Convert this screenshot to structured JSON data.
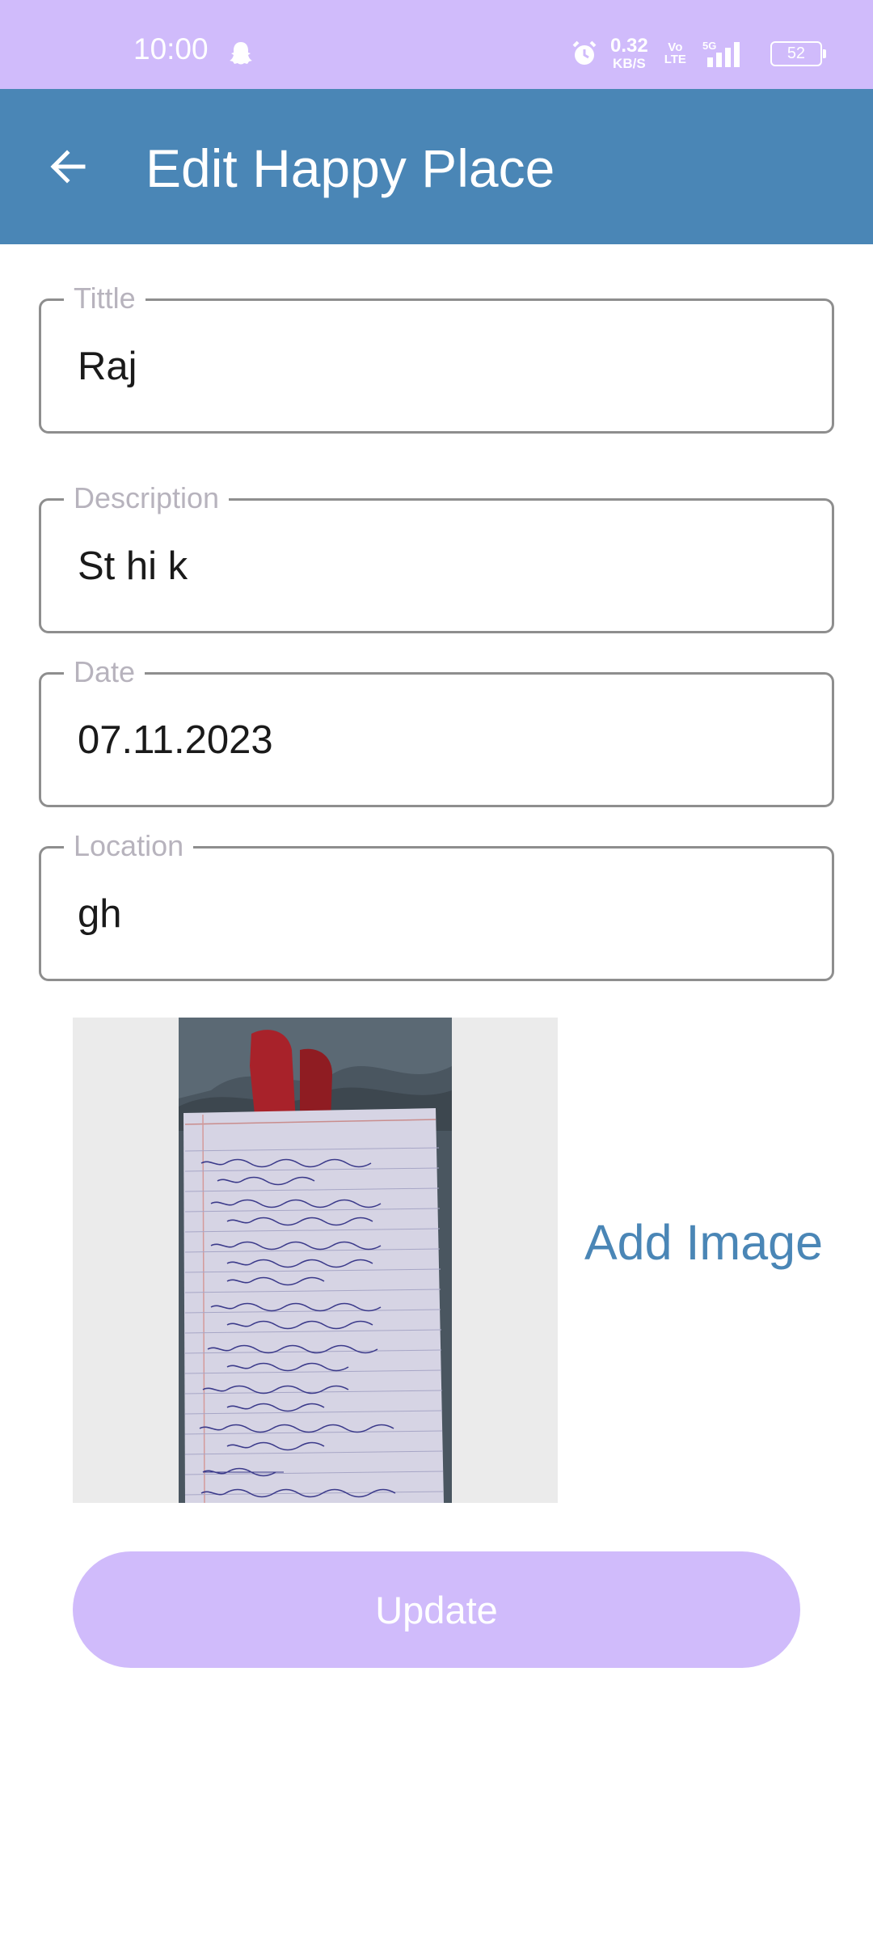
{
  "status_bar": {
    "time": "10:00",
    "net_speed_value": "0.32",
    "net_speed_unit": "KB/S",
    "volte_top": "Vo",
    "volte_bottom": "LTE",
    "network_type": "5G",
    "battery": "52",
    "icons": [
      "snapchat-ghost-icon",
      "alarm-icon",
      "signal-icon",
      "battery-icon"
    ]
  },
  "app_bar": {
    "title": "Edit Happy Place",
    "back_icon": "arrow-back-icon",
    "background_color": "#4a86b6"
  },
  "form": {
    "title": {
      "label": "Tittle",
      "value": "Raj"
    },
    "description": {
      "label": "Description",
      "value": "St hi k"
    },
    "date": {
      "label": "Date",
      "value": "07.11.2023"
    },
    "location": {
      "label": "Location",
      "value": "gh"
    }
  },
  "image_section": {
    "add_image_label": "Add Image",
    "preview_alt": "photo of a handwritten notebook page"
  },
  "update_button": {
    "label": "Update",
    "color": "#d0bbfb"
  },
  "colors": {
    "status_bar": "#d0bbfb",
    "accent": "#4a86b6",
    "field_border": "#8e8e8e",
    "field_label": "#b7b3bd"
  }
}
